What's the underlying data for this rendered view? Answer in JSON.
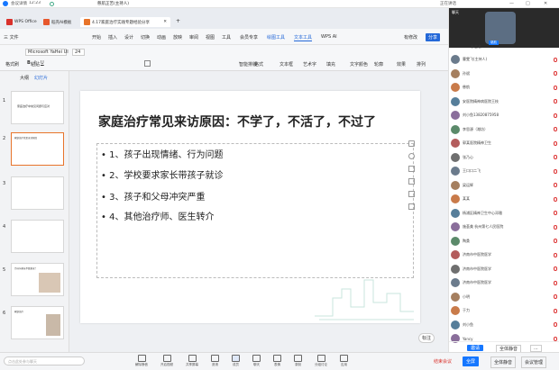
{
  "meeting": {
    "time": "12:23",
    "title": "会议详情",
    "host": "慈航正苦(主持人)",
    "speaker": "正在讲话",
    "speaker_name": "慈航",
    "chat_title": "聊天",
    "member_title": "会议成员",
    "participants_label": "参会者"
  },
  "wps": {
    "tabs": [
      {
        "label": "WPS Office"
      },
      {
        "label": "稻壳AI模板"
      },
      {
        "label": "4.17家庭治疗实践专题经验分享"
      }
    ],
    "menu": [
      "三 文件",
      "开始",
      "插入",
      "设计",
      "切换",
      "动画",
      "放映",
      "审阅",
      "视图",
      "工具",
      "会员专享",
      "绘图工具",
      "文本工具",
      "WPS AI"
    ],
    "menu_right": [
      "有修改",
      "分享"
    ],
    "ribbon": {
      "font": "Microsoft YaHei UI",
      "size": "24",
      "groups": [
        "格式刷",
        "粘贴",
        "复制",
        "剪切",
        "智能排版",
        "格式",
        "文本框",
        "形状",
        "排列",
        "线条",
        "填充",
        "编辑",
        "艺术字",
        "轮廓",
        "效果",
        "对齐",
        "文字颜色",
        "段落",
        "文本效果"
      ]
    },
    "sidebar_tabs": [
      "大纲",
      "幻灯片"
    ],
    "slide_numbers": [
      "1",
      "2",
      "3",
      "4",
      "5",
      "6"
    ]
  },
  "slide": {
    "title": "家庭治疗常见来访原因：不学了，不活了，不过了",
    "bullets": [
      "1、孩子出现情绪、行为问题",
      "2、学校要求家长带孩子就诊",
      "3、孩子和父母冲突严重",
      "4、其他治疗师、医生转介"
    ]
  },
  "thumbs": {
    "t1": "家庭治疗中常见问题与应对",
    "t2": "家庭治疗常见来访原因",
    "t5": "为什么家长不愿意来？",
    "t6": "家庭治疗"
  },
  "status": {
    "slide": "幻灯片 2/36",
    "theme": "默认设计",
    "zoom": "72%",
    "smart": "智能美化",
    "edit": "标注",
    "comment": "批注"
  },
  "toolbar": [
    "解除静音",
    "开启视频",
    "共享屏幕",
    "邀请",
    "成员",
    "聊天",
    "表情",
    "录制",
    "分组讨论",
    "应用",
    "设置"
  ],
  "toolbar_right": [
    "结束会议",
    "全屏",
    "会议管理"
  ],
  "members": [
    "曹雯飞(主持人)",
    "孙斌",
    "慈航",
    "安医院精神病医院王枝",
    "刘小鱼13820875958",
    "李思源（潍坊）",
    "郭某医院精神卫生",
    "张乃心",
    "王口口二飞",
    "梁运辉",
    "某某",
    "杨浦区精神卫生中心邓雅",
    "施荟美 杭州第七人民医院",
    "陶桑",
    "济南市中医院医学",
    "济南市中医院医学",
    "济南市中医院医学",
    "小明",
    "于力",
    "刘小鱼",
    "Yancy"
  ],
  "panel_footer": {
    "invite": "邀请",
    "all_mute": "全体静音",
    "more": "...",
    "send": "发送",
    "chat_placeholder": "点击此处参与聊天"
  },
  "colors": {
    "accent": "#4a8af4",
    "wps_red": "#d9312b",
    "meeting_blue": "#1677ff"
  }
}
